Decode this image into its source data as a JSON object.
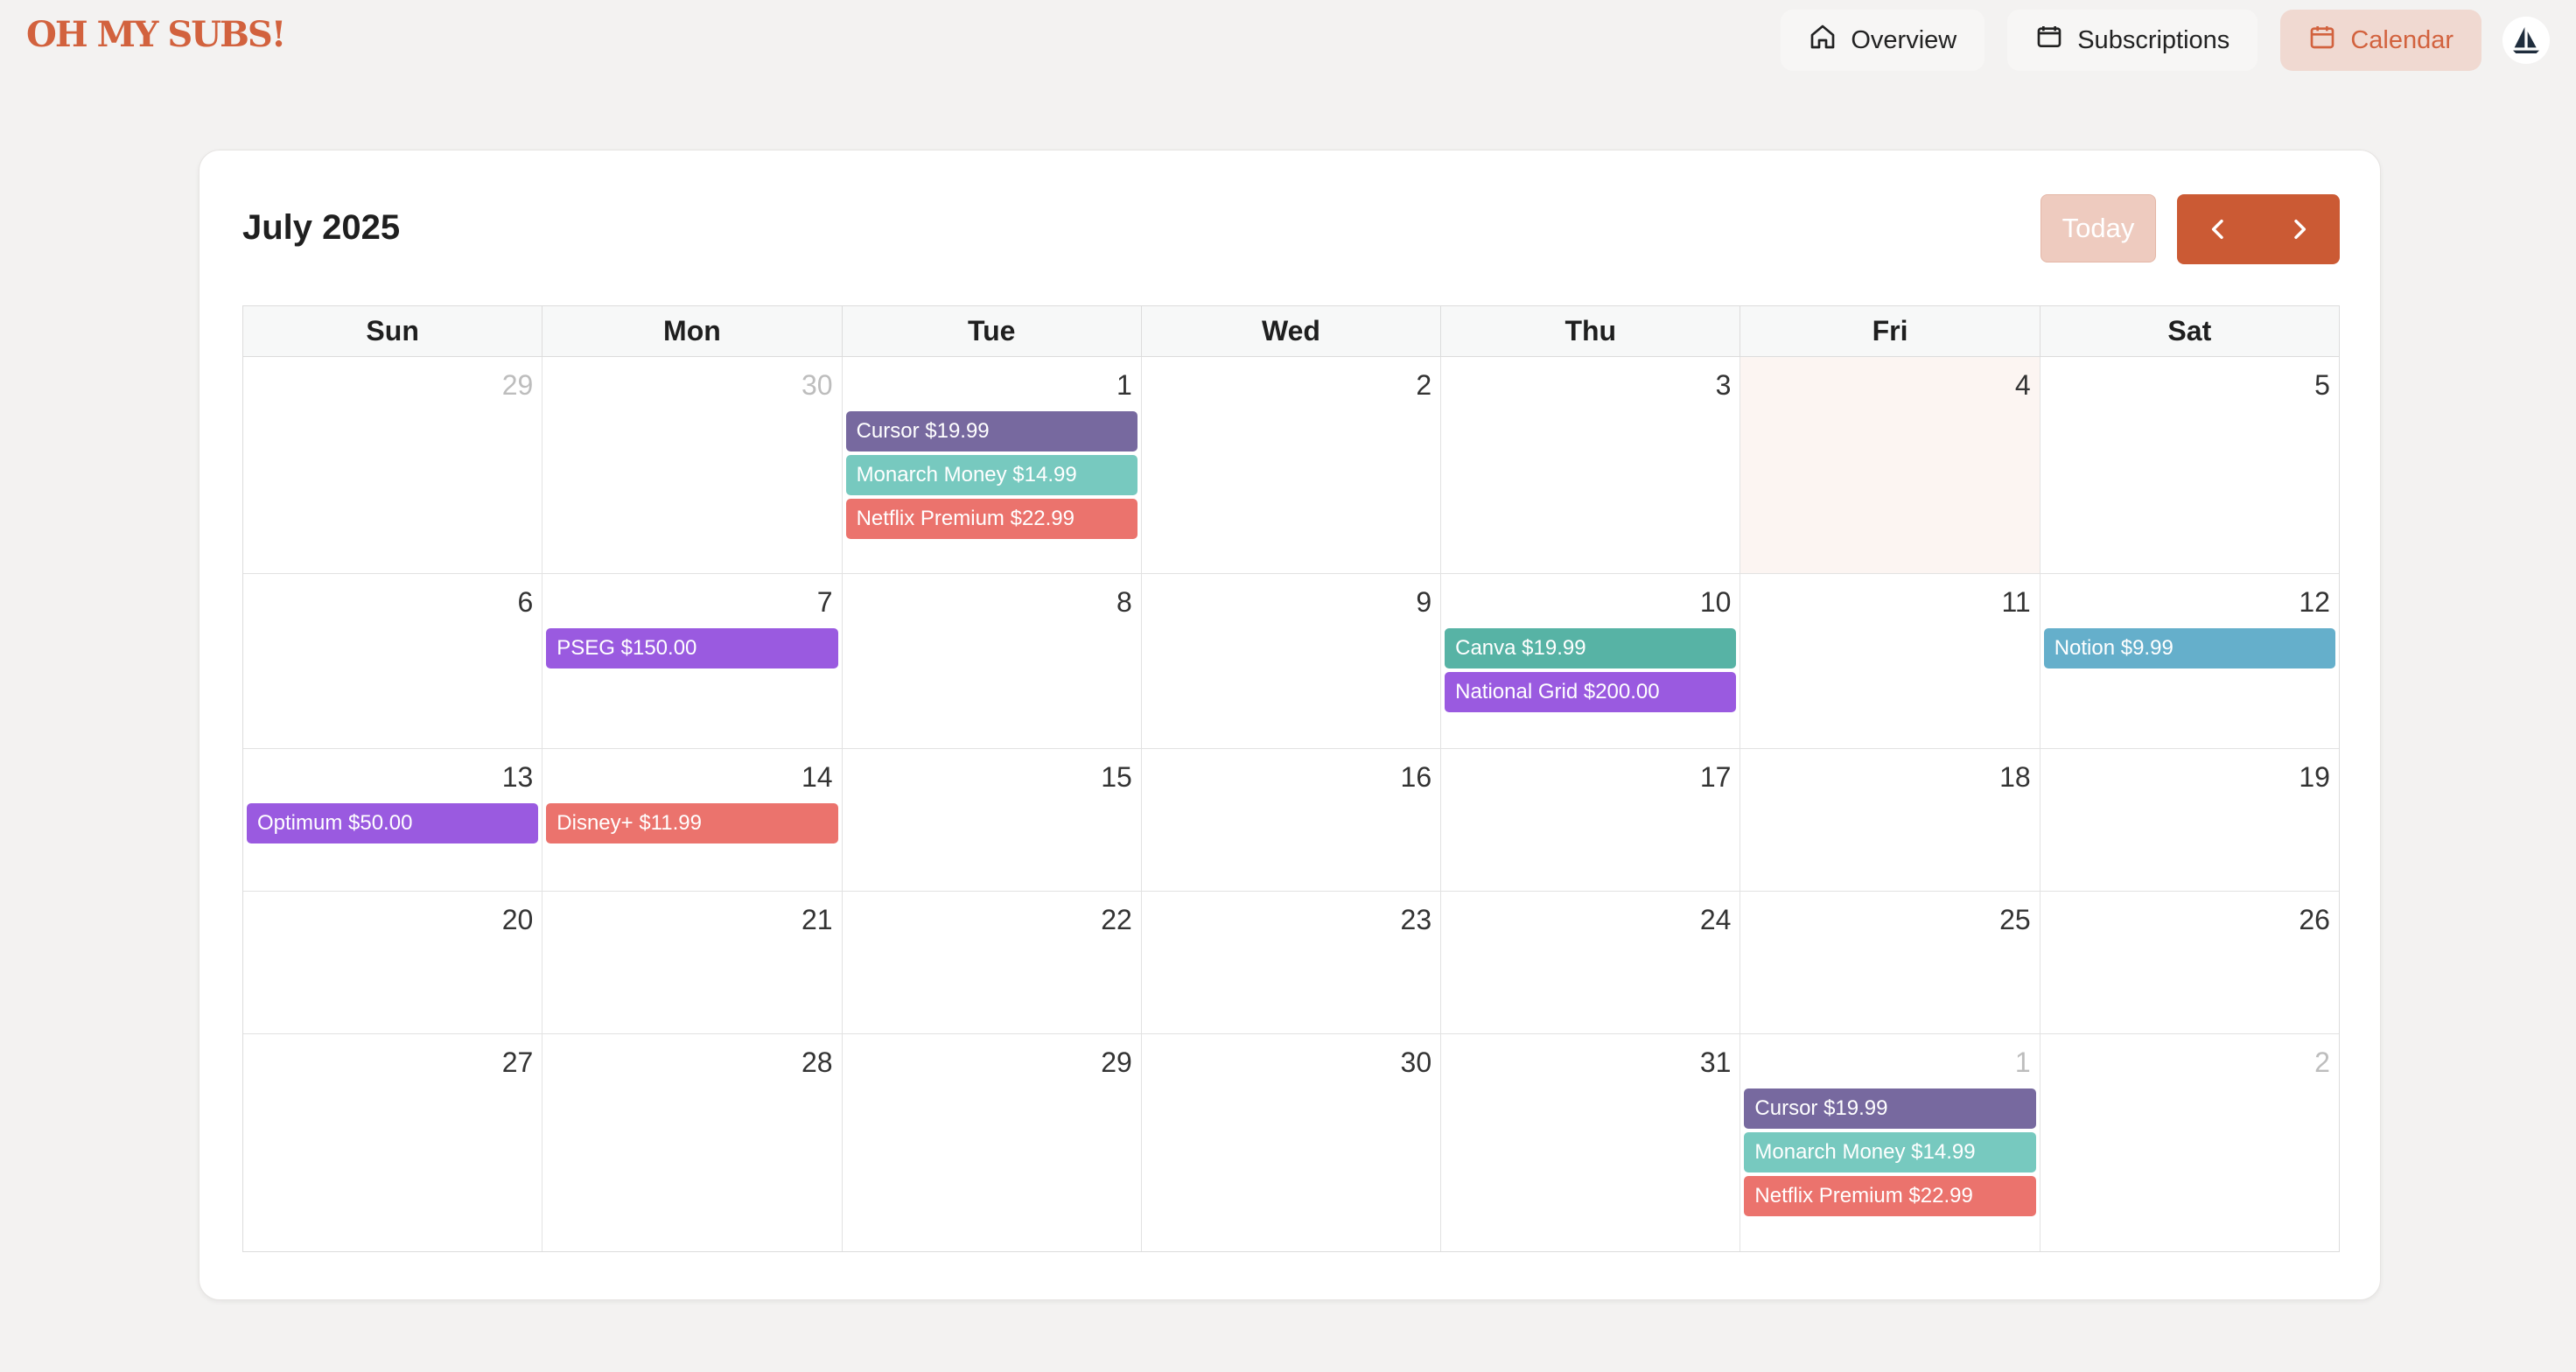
{
  "app": {
    "logo_text": "OH MY SUBS!"
  },
  "nav": {
    "items": [
      {
        "label": "Overview",
        "icon": "home-icon",
        "active": false
      },
      {
        "label": "Subscriptions",
        "icon": "wallet-icon",
        "active": false
      },
      {
        "label": "Calendar",
        "icon": "calendar-icon",
        "active": true
      }
    ]
  },
  "calendar": {
    "month_title": "July 2025",
    "today_label": "Today",
    "weekdays": [
      "Sun",
      "Mon",
      "Tue",
      "Wed",
      "Thu",
      "Fri",
      "Sat"
    ],
    "colors": {
      "accent": "#cb5a34",
      "cursor": "#77699f",
      "monarch": "#77c9bf",
      "netflix": "#eb736d",
      "utility": "#9a5ae0",
      "canva": "#57b3a5",
      "notion": "#65afcb"
    },
    "weeks": [
      [
        {
          "day": "29",
          "other": true,
          "events": []
        },
        {
          "day": "30",
          "other": true,
          "events": []
        },
        {
          "day": "1",
          "events": [
            {
              "label": "Cursor $19.99",
              "color": "#77699f"
            },
            {
              "label": "Monarch Money $14.99",
              "color": "#77c9bf"
            },
            {
              "label": "Netflix Premium $22.99",
              "color": "#eb736d"
            }
          ]
        },
        {
          "day": "2",
          "events": []
        },
        {
          "day": "3",
          "events": []
        },
        {
          "day": "4",
          "today": true,
          "events": []
        },
        {
          "day": "5",
          "events": []
        }
      ],
      [
        {
          "day": "6",
          "events": []
        },
        {
          "day": "7",
          "events": [
            {
              "label": "PSEG $150.00",
              "color": "#9a5ae0"
            }
          ]
        },
        {
          "day": "8",
          "events": []
        },
        {
          "day": "9",
          "events": []
        },
        {
          "day": "10",
          "events": [
            {
              "label": "Canva $19.99",
              "color": "#57b3a5"
            },
            {
              "label": "National Grid $200.00",
              "color": "#9a5ae0"
            }
          ]
        },
        {
          "day": "11",
          "events": []
        },
        {
          "day": "12",
          "events": [
            {
              "label": "Notion $9.99",
              "color": "#65afcb"
            }
          ]
        }
      ],
      [
        {
          "day": "13",
          "events": [
            {
              "label": "Optimum $50.00",
              "color": "#9a5ae0"
            }
          ]
        },
        {
          "day": "14",
          "events": [
            {
              "label": "Disney+ $11.99",
              "color": "#eb736d"
            }
          ]
        },
        {
          "day": "15",
          "events": []
        },
        {
          "day": "16",
          "events": []
        },
        {
          "day": "17",
          "events": []
        },
        {
          "day": "18",
          "events": []
        },
        {
          "day": "19",
          "events": []
        }
      ],
      [
        {
          "day": "20",
          "events": []
        },
        {
          "day": "21",
          "events": []
        },
        {
          "day": "22",
          "events": []
        },
        {
          "day": "23",
          "events": []
        },
        {
          "day": "24",
          "events": []
        },
        {
          "day": "25",
          "events": []
        },
        {
          "day": "26",
          "events": []
        }
      ],
      [
        {
          "day": "27",
          "events": []
        },
        {
          "day": "28",
          "events": []
        },
        {
          "day": "29",
          "events": []
        },
        {
          "day": "30",
          "events": []
        },
        {
          "day": "31",
          "events": []
        },
        {
          "day": "1",
          "other": true,
          "events": [
            {
              "label": "Cursor $19.99",
              "color": "#77699f"
            },
            {
              "label": "Monarch Money $14.99",
              "color": "#77c9bf"
            },
            {
              "label": "Netflix Premium $22.99",
              "color": "#eb736d"
            }
          ]
        },
        {
          "day": "2",
          "other": true,
          "events": []
        }
      ]
    ]
  }
}
